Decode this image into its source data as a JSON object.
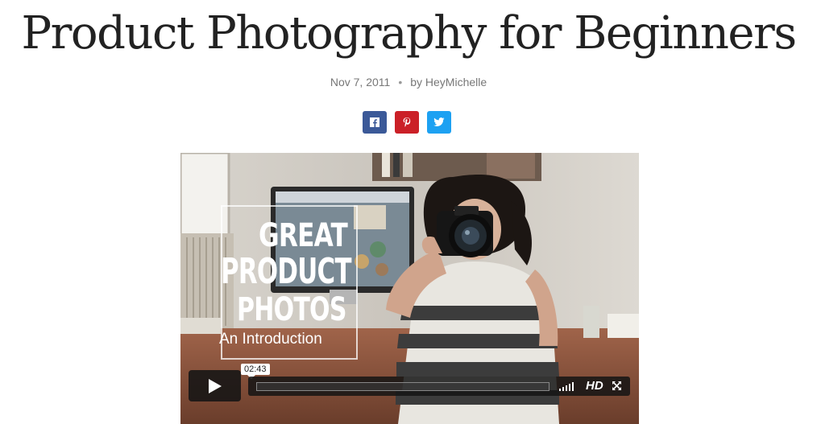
{
  "article": {
    "title": "Product Photography for Beginners",
    "date": "Nov 7, 2011",
    "separator": "•",
    "author": "by HeyMichelle"
  },
  "share": {
    "buttons": [
      {
        "icon": "facebook-icon",
        "color": "#3b5998"
      },
      {
        "icon": "pinterest-icon",
        "color": "#cb2027"
      },
      {
        "icon": "twitter-icon",
        "color": "#1da1f2"
      }
    ]
  },
  "video": {
    "overlay": {
      "line1": "GREAT",
      "line2": "PRODUCT",
      "line3": "PHOTOS",
      "line4": "An Introduction"
    },
    "player": {
      "timecode": "02:43",
      "hd_label": "HD",
      "progress_fraction": 0.0,
      "accent_color": "#00adef"
    }
  }
}
